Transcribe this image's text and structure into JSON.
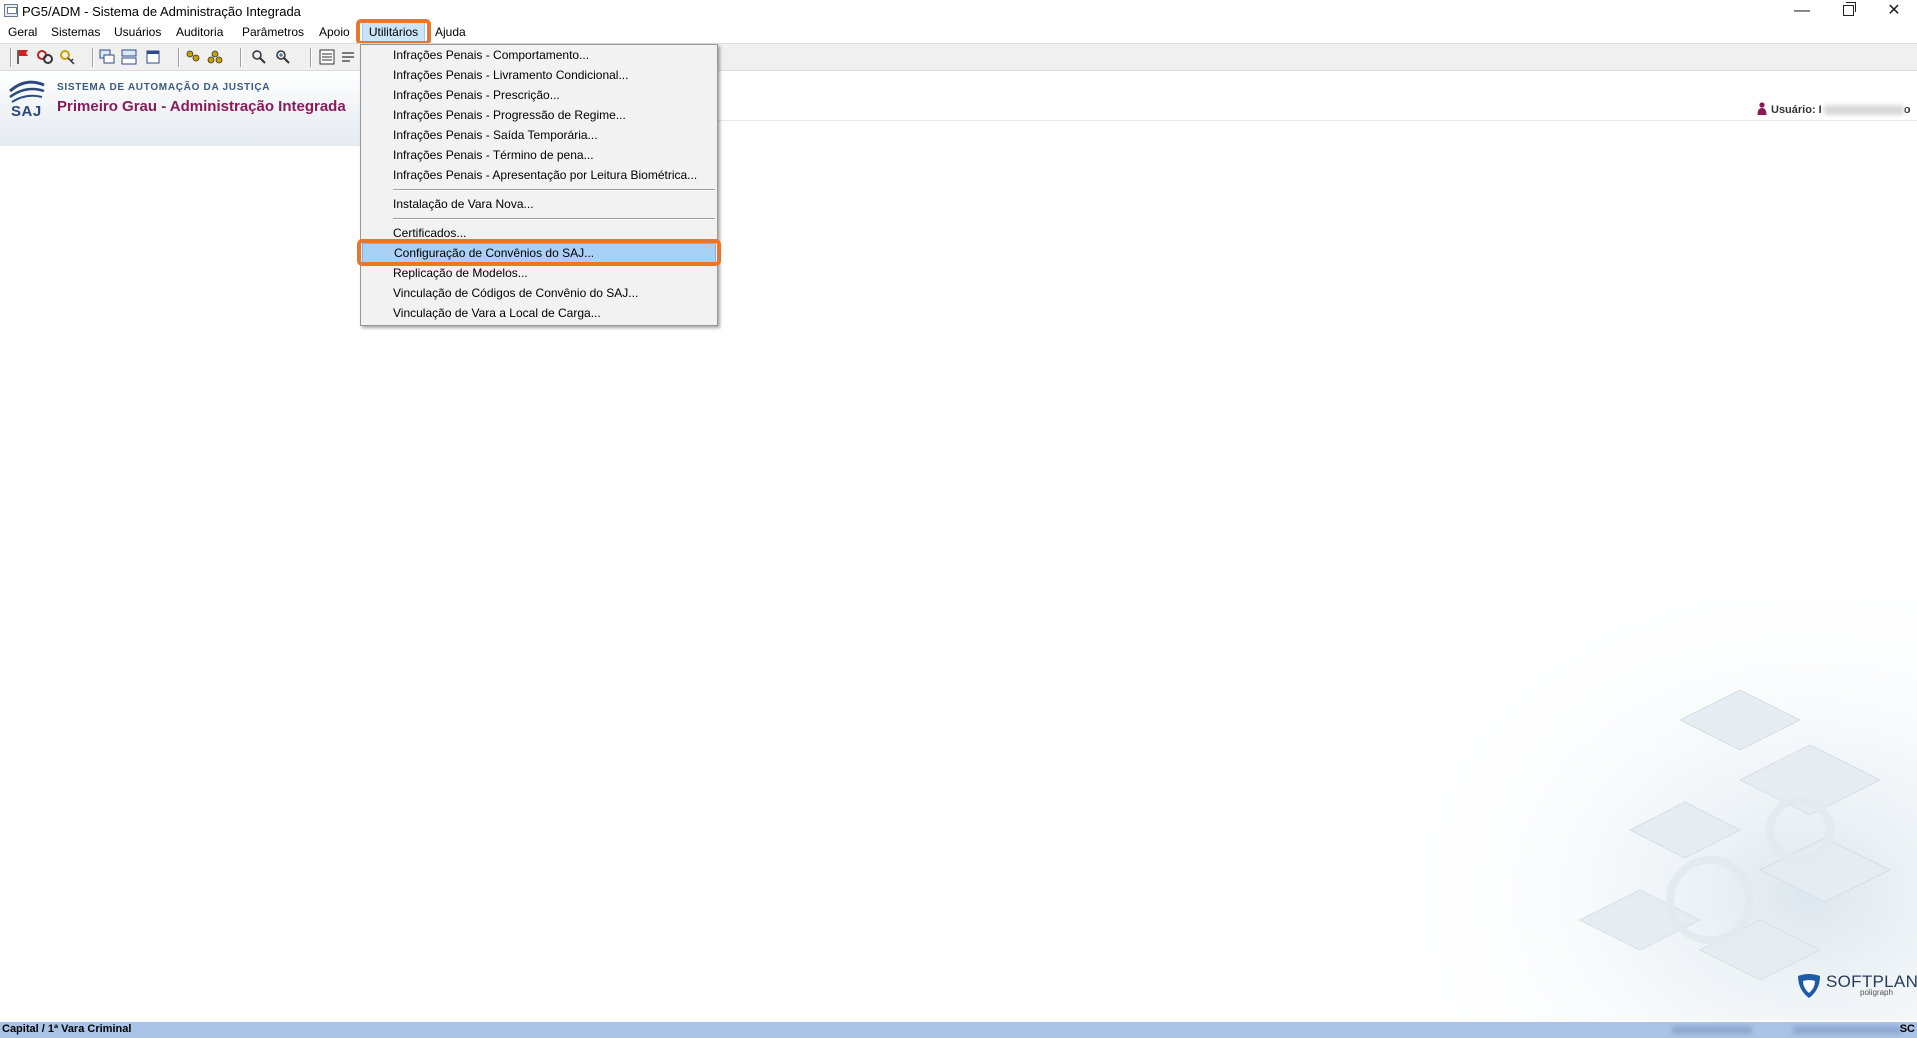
{
  "window": {
    "title": "PG5/ADM - Sistema de Administração Integrada"
  },
  "menubar": {
    "items": [
      "Geral",
      "Sistemas",
      "Usuários",
      "Auditoria",
      "Parâmetros",
      "Apoio",
      "Utilitários",
      "Ajuda"
    ],
    "active": "Utilitários"
  },
  "header": {
    "logo_text": "SAJ",
    "system_title": "SISTEMA DE AUTOMAÇÃO DA JUSTIÇA",
    "subtitle": "Primeiro Grau - Administração Integrada",
    "user_label": "Usuário: I",
    "user_suffix": "o"
  },
  "dropdown": {
    "items": [
      "Infrações Penais - Comportamento...",
      "Infrações Penais - Livramento Condicional...",
      "Infrações Penais - Prescrição...",
      "Infrações Penais - Progressão de Regime...",
      "Infrações Penais - Saída Temporária...",
      "Infrações Penais - Término de pena...",
      "Infrações Penais - Apresentação por Leitura Biométrica...",
      "Instalação de Vara Nova...",
      "Certificados...",
      "Configuração de Convênios do SAJ...",
      "Replicação de Modelos...",
      "Vinculação de Códigos de Convênio do SAJ...",
      "Vinculação de Vara a Local de Carga..."
    ],
    "selected": "Configuração de Convênios do SAJ..."
  },
  "statusbar": {
    "location": "Capital / 1ª Vara Criminal",
    "state": "SC"
  },
  "brand": {
    "name": "SOFTPLAN",
    "sub": "poligraph"
  },
  "icons": [
    "window-app-icon",
    "minimize-icon",
    "maximize-icon",
    "close-icon",
    "user-icon",
    "softplan-logo-icon"
  ],
  "colors": {
    "highlight_outline": "#e8772e",
    "selected_item": "#a9d0f5",
    "subtitle": "#8b1a5a",
    "statusbar": "#a9c3e6"
  }
}
